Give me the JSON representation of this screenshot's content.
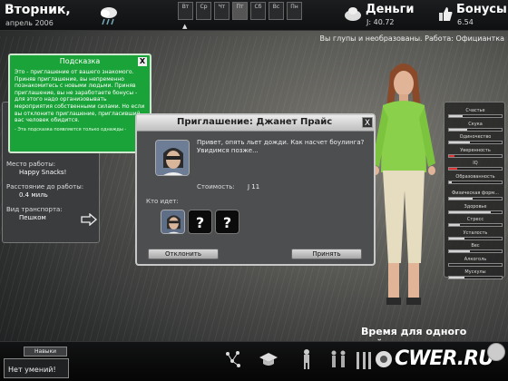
{
  "header": {
    "day_name": "Вторник,",
    "date": "апрель 2006",
    "weather_icon": "rain-cloud-icon",
    "week_days": [
      "Вт",
      "Ср",
      "Чт",
      "Пт",
      "Сб",
      "Вс",
      "Пн"
    ],
    "week_active_index": 3,
    "money_title": "Деньги",
    "money_value": "Ј: 40.72",
    "bonus_title": "Бонусы",
    "bonus_value": "6.54",
    "status_line": "Вы глупы и необразованы. Работа: Официантка"
  },
  "hint": {
    "title": "Подсказка",
    "close_label": "X",
    "body": "Это - приглашение от вашего знакомого. Приняв приглашение, вы непременно познакомитесь с новыми людьми. Приняв приглашение, вы не заработаете бонусы - для этого надо организовывать мероприятия собственными силами. Но если вы отклоните приглашение, пригласивший вас человек обидится.",
    "footer": "- Эта подсказка появляется только однажды -"
  },
  "job_panel": {
    "workplace_label": "Место работы:",
    "workplace_value": "Happy Snacks!",
    "distance_label": "Расстояние до работы:",
    "distance_value": "0.4 миль",
    "transport_label": "Вид транспорта:",
    "transport_value": "Пешком"
  },
  "dialog": {
    "title": "Приглашение: Джанет Прайс",
    "close_label": "X",
    "message": "Привет, опять льет дожди. Как насчет боулинга? Увидимся позже...",
    "cost_label": "Стоимость:",
    "cost_value": "Ј 11",
    "who_label": "Кто идет:",
    "unknown_mark": "?",
    "reject_label": "Отклонить",
    "accept_label": "Принять"
  },
  "stats": [
    {
      "label": "Счастье",
      "value": 0.25,
      "color": "#d4d4d4"
    },
    {
      "label": "Скука",
      "value": 0.35,
      "color": "#d4d4d4"
    },
    {
      "label": "Одиночество",
      "value": 0.4,
      "color": "#d4d4d4"
    },
    {
      "label": "Уверенность",
      "value": 0.1,
      "color": "#d33"
    },
    {
      "label": "IQ",
      "value": 0.15,
      "color": "#d33"
    },
    {
      "label": "Образованность",
      "value": 0.05,
      "color": "#d4d4d4"
    },
    {
      "label": "Физическая форм...",
      "value": 0.45,
      "color": "#d4d4d4"
    },
    {
      "label": "Здоровье",
      "value": 0.8,
      "color": "#d4d4d4"
    },
    {
      "label": "Стресс",
      "value": 0.2,
      "color": "#d4d4d4"
    },
    {
      "label": "Усталость",
      "value": 0.3,
      "color": "#d4d4d4"
    },
    {
      "label": "Вес",
      "value": 0.4,
      "color": "#d4d4d4"
    },
    {
      "label": "Алкоголь",
      "value": 0.0,
      "color": "#d4d4d4"
    },
    {
      "label": "Мускулы",
      "value": 0.3,
      "color": "#d4d4d4"
    }
  ],
  "bottom": {
    "time_text": "Время для одного действия...",
    "skills_tab": "Навыки",
    "skills_text": "Нет умений!",
    "watermark": "CWER.RU",
    "icons": [
      "map-icon",
      "graduation-cap-icon",
      "person-icon",
      "group-icon",
      "ladder-icon",
      "vehicle-icon",
      "clock-icon"
    ]
  }
}
